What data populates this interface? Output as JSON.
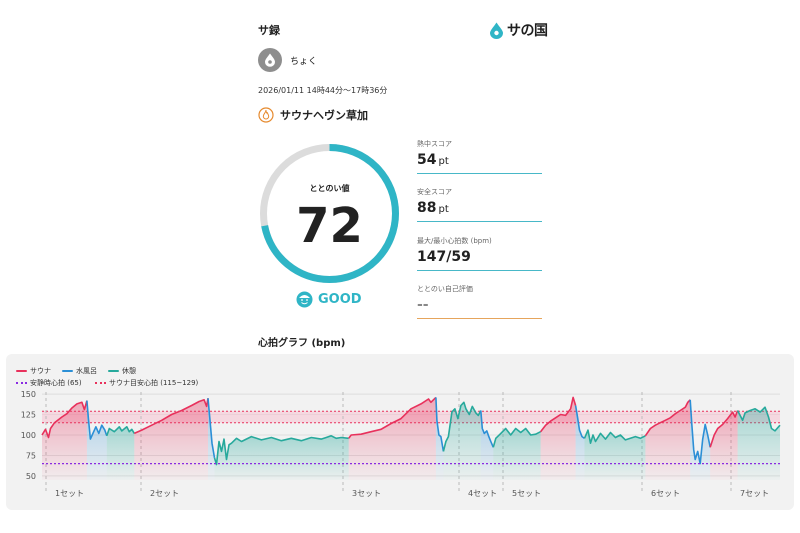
{
  "header": {
    "title": "サ録",
    "brand_text": "サの国",
    "brand_color": "#2fb5c6"
  },
  "user": {
    "name": "ちょく",
    "avatar_icon": "water-drop-icon"
  },
  "session": {
    "datetime": "2026/01/11 14時44分〜17時36分",
    "facility_icon": "flame-badge-icon",
    "facility_name": "サウナヘヴン草加"
  },
  "score": {
    "label": "ととのい値",
    "value": "72",
    "fraction": 0.72,
    "rating": "GOOD",
    "rating_icon": "smiling-face-icon",
    "accent": "#2fb5c6"
  },
  "metrics": [
    {
      "label": "熱中スコア",
      "value": "54",
      "unit": "pt"
    },
    {
      "label": "安全スコア",
      "value": "88",
      "unit": "pt"
    },
    {
      "label": "最大/最小心拍数 (bpm)",
      "value": "147/59",
      "unit": ""
    },
    {
      "label": "ととのい自己評価",
      "value": "--",
      "unit": ""
    }
  ],
  "chart_title": "心拍グラフ (bpm)",
  "chart_data": {
    "type": "area",
    "ylim": [
      45,
      155
    ],
    "yticks": [
      150,
      125,
      100,
      75,
      50
    ],
    "grid": true,
    "legend": [
      {
        "label": "サウナ",
        "color": "#e8315c",
        "style": "solid"
      },
      {
        "label": "水風呂",
        "color": "#2b8fd6",
        "style": "solid"
      },
      {
        "label": "休憩",
        "color": "#27a99c",
        "style": "solid"
      },
      {
        "label": "安静時心拍 (65)",
        "color": "#8a2be2",
        "style": "dotted"
      },
      {
        "label": "サウナ目安心拍 (115~129)",
        "color": "#e8315c",
        "style": "dotted"
      }
    ],
    "resting_hr": 65,
    "sauna_band": [
      115,
      129
    ],
    "set_labels": [
      "1セット",
      "2セット",
      "3セット",
      "4セット",
      "5セット",
      "6セット",
      "7セット"
    ],
    "set_starts": [
      0,
      12,
      40,
      56,
      62,
      81,
      92
    ],
    "x_max": 100,
    "segments": [
      {
        "phase": "sauna",
        "points": [
          [
            0,
            100
          ],
          [
            0.7,
            107
          ],
          [
            1.3,
            97
          ],
          [
            1.7,
            108
          ],
          [
            2.5,
            115
          ],
          [
            4,
            122
          ],
          [
            5,
            126
          ],
          [
            6,
            133
          ],
          [
            7,
            138
          ],
          [
            8,
            140
          ],
          [
            8.5,
            131
          ],
          [
            9,
            142
          ]
        ]
      },
      {
        "phase": "cold",
        "points": [
          [
            9,
            142
          ],
          [
            9.3,
            120
          ],
          [
            9.7,
            95
          ],
          [
            10.2,
            102
          ],
          [
            10.8,
            110
          ],
          [
            11.4,
            102
          ],
          [
            12,
            112
          ],
          [
            12.6,
            106
          ],
          [
            13,
            99
          ]
        ]
      },
      {
        "phase": "rest",
        "points": [
          [
            13,
            99
          ],
          [
            13.5,
            108
          ],
          [
            14.5,
            104
          ],
          [
            15.5,
            110
          ],
          [
            16,
            105
          ],
          [
            17,
            110
          ],
          [
            17.5,
            104
          ],
          [
            18,
            107
          ],
          [
            18.5,
            102
          ]
        ]
      },
      {
        "phase": "sauna",
        "points": [
          [
            18.5,
            102
          ],
          [
            20,
            106
          ],
          [
            22,
            112
          ],
          [
            24,
            118
          ],
          [
            26,
            125
          ],
          [
            28,
            130
          ],
          [
            30,
            136
          ],
          [
            31.5,
            141
          ],
          [
            32.5,
            143
          ],
          [
            33,
            135
          ],
          [
            33.3,
            145
          ]
        ]
      },
      {
        "phase": "cold",
        "points": [
          [
            33.3,
            145
          ],
          [
            33.7,
            118
          ],
          [
            34.1,
            90
          ],
          [
            34.6,
            72
          ]
        ]
      },
      {
        "phase": "rest",
        "points": [
          [
            34.6,
            72
          ],
          [
            35,
            64
          ],
          [
            35.5,
            92
          ],
          [
            36,
            80
          ],
          [
            36.5,
            95
          ],
          [
            37,
            70
          ],
          [
            37.5,
            88
          ],
          [
            38,
            90
          ],
          [
            39,
            96
          ],
          [
            40,
            92
          ],
          [
            42,
            98
          ],
          [
            44,
            94
          ],
          [
            46,
            97
          ],
          [
            48,
            93
          ],
          [
            50,
            96
          ],
          [
            52,
            93
          ],
          [
            54,
            97
          ],
          [
            56,
            95
          ],
          [
            57,
            97
          ],
          [
            58,
            99
          ],
          [
            59,
            96
          ],
          [
            60,
            97
          ],
          [
            61.5,
            96
          ]
        ]
      },
      {
        "phase": "sauna",
        "points": [
          [
            61.5,
            96
          ],
          [
            62,
            100
          ],
          [
            64,
            101
          ],
          [
            66,
            104
          ],
          [
            68,
            107
          ],
          [
            70,
            114
          ],
          [
            72,
            120
          ],
          [
            73,
            126
          ],
          [
            74,
            132
          ],
          [
            76,
            138
          ],
          [
            77.5,
            144
          ],
          [
            78,
            140
          ],
          [
            79,
            146
          ]
        ]
      },
      {
        "phase": "cold",
        "points": [
          [
            79,
            146
          ],
          [
            79.2,
            118
          ],
          [
            79.6,
            100
          ],
          [
            80,
            98
          ],
          [
            80.5,
            80
          ]
        ]
      },
      {
        "phase": "rest",
        "points": [
          [
            80.5,
            80
          ],
          [
            81,
            92
          ],
          [
            81.5,
            98
          ],
          [
            82.2,
            128
          ],
          [
            82.8,
            132
          ],
          [
            83.4,
            120
          ],
          [
            84,
            136
          ],
          [
            84.6,
            140
          ],
          [
            85,
            132
          ],
          [
            85.7,
            125
          ],
          [
            86.3,
            135
          ],
          [
            87,
            127
          ],
          [
            87.5,
            124
          ],
          [
            88,
            130
          ]
        ]
      },
      {
        "phase": "cold",
        "points": [
          [
            88,
            130
          ],
          [
            88.3,
            108
          ],
          [
            88.7,
            102
          ],
          [
            89.2,
            105
          ],
          [
            89.6,
            98
          ],
          [
            90,
            92
          ],
          [
            90.5,
            85
          ]
        ]
      },
      {
        "phase": "rest",
        "points": [
          [
            90.5,
            85
          ],
          [
            91,
            96
          ],
          [
            92,
            102
          ],
          [
            93,
            108
          ],
          [
            94,
            100
          ],
          [
            95,
            108
          ],
          [
            96,
            103
          ],
          [
            97,
            108
          ],
          [
            98,
            100
          ],
          [
            99,
            101
          ],
          [
            100,
            104
          ]
        ]
      },
      {
        "phase": "sauna",
        "points": [
          [
            100,
            104
          ],
          [
            101,
            112
          ],
          [
            102,
            117
          ],
          [
            103,
            121
          ],
          [
            104,
            125
          ],
          [
            105,
            124
          ],
          [
            106,
            132
          ],
          [
            106.5,
            146
          ],
          [
            107,
            136
          ]
        ]
      },
      {
        "phase": "cold",
        "points": [
          [
            107,
            136
          ],
          [
            107.4,
            122
          ],
          [
            107.8,
            106
          ],
          [
            108.3,
            98
          ],
          [
            108.8,
            96
          ]
        ]
      },
      {
        "phase": "rest",
        "points": [
          [
            108.8,
            96
          ],
          [
            109.5,
            106
          ],
          [
            110,
            90
          ],
          [
            110.5,
            100
          ],
          [
            111,
            92
          ],
          [
            112,
            102
          ],
          [
            113,
            95
          ],
          [
            114,
            103
          ],
          [
            115,
            97
          ],
          [
            116,
            100
          ],
          [
            117,
            94
          ],
          [
            118,
            96
          ],
          [
            119,
            98
          ],
          [
            120,
            96
          ],
          [
            121,
            99
          ]
        ]
      },
      {
        "phase": "sauna",
        "points": [
          [
            121,
            99
          ],
          [
            122,
            108
          ],
          [
            123,
            112
          ],
          [
            124,
            115
          ],
          [
            125,
            118
          ],
          [
            126,
            121
          ],
          [
            127,
            126
          ],
          [
            128,
            130
          ],
          [
            129,
            134
          ],
          [
            129.5,
            140
          ],
          [
            130,
            143
          ]
        ]
      },
      {
        "phase": "cold",
        "points": [
          [
            130,
            143
          ],
          [
            130.3,
            115
          ],
          [
            130.7,
            82
          ],
          [
            131,
            70
          ],
          [
            131.5,
            80
          ],
          [
            132,
            65
          ],
          [
            132.5,
            95
          ],
          [
            133,
            113
          ],
          [
            133.5,
            100
          ],
          [
            134,
            85
          ]
        ]
      },
      {
        "phase": "sauna",
        "points": [
          [
            134,
            85
          ],
          [
            134.8,
            100
          ],
          [
            135.5,
            108
          ],
          [
            136.5,
            113
          ],
          [
            137.5,
            120
          ],
          [
            138.5,
            128
          ],
          [
            139,
            122
          ],
          [
            139.5,
            130
          ]
        ]
      },
      {
        "phase": "rest",
        "points": [
          [
            139.5,
            130
          ],
          [
            140.5,
            118
          ],
          [
            141,
            127
          ],
          [
            142,
            130
          ],
          [
            143,
            132
          ],
          [
            144,
            128
          ],
          [
            145,
            134
          ],
          [
            145.7,
            122
          ],
          [
            146.3,
            108
          ],
          [
            147,
            105
          ],
          [
            148,
            112
          ]
        ]
      }
    ]
  }
}
